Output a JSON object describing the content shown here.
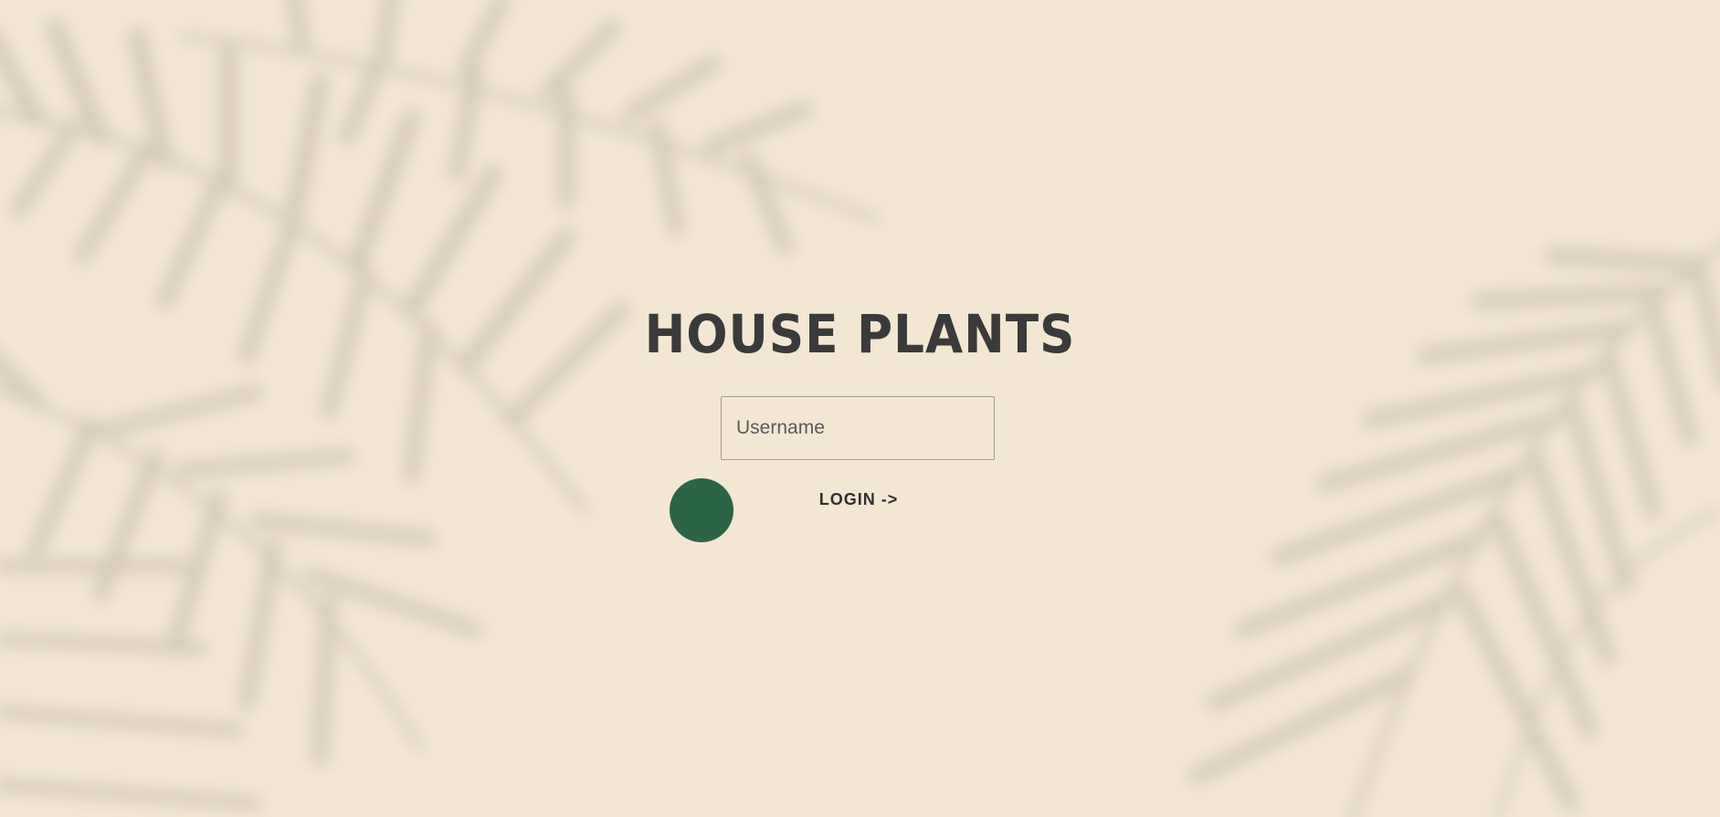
{
  "app": {
    "title": "HOUSE PLANTS"
  },
  "login_form": {
    "username_placeholder": "Username",
    "username_value": "",
    "login_label": "LOGIN ->"
  },
  "colors": {
    "background": "#f3e7d3",
    "title": "#3a3a3a",
    "accent_dot": "#2c6446",
    "input_border": "#a39a90",
    "leaf_shadow": "#d3c7b4"
  },
  "decor": {
    "background_image": "palm-leaf-shadow"
  }
}
